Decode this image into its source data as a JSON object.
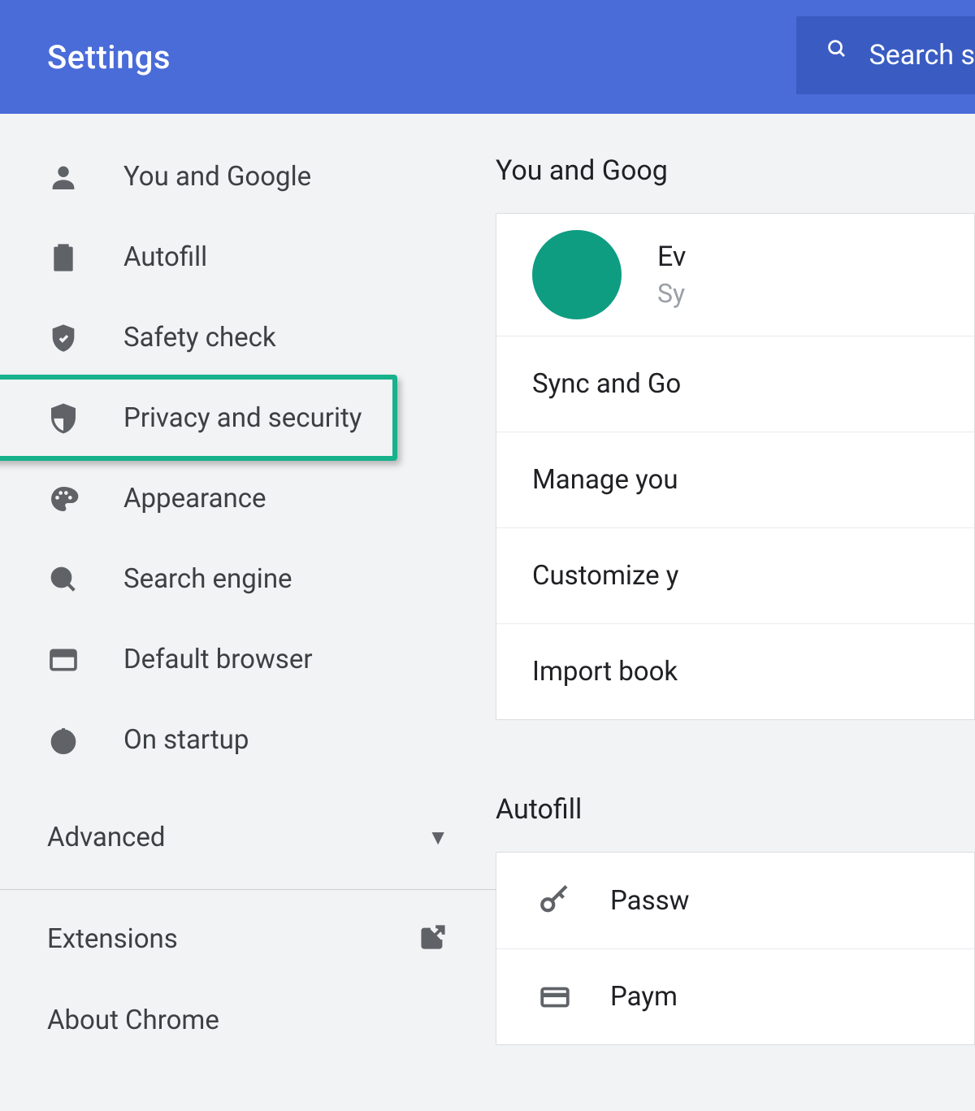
{
  "header": {
    "title": "Settings",
    "search_label": "Search s"
  },
  "sidebar": {
    "items": [
      {
        "id": "you-and-google",
        "icon": "person",
        "label": "You and Google"
      },
      {
        "id": "autofill",
        "icon": "clipboard",
        "label": "Autofill"
      },
      {
        "id": "safety-check",
        "icon": "shield-check",
        "label": "Safety check"
      },
      {
        "id": "privacy",
        "icon": "shield-half",
        "label": "Privacy and security",
        "highlighted": true
      },
      {
        "id": "appearance",
        "icon": "palette",
        "label": "Appearance"
      },
      {
        "id": "search-engine",
        "icon": "search",
        "label": "Search engine"
      },
      {
        "id": "default-browser",
        "icon": "browser",
        "label": "Default browser"
      },
      {
        "id": "on-startup",
        "icon": "power",
        "label": "On startup"
      }
    ],
    "advanced_label": "Advanced",
    "extensions_label": "Extensions",
    "about_label": "About Chrome"
  },
  "main": {
    "section1_title": "You and Goog",
    "profile": {
      "name": "Ev",
      "sub": "Sy",
      "avatar_color": "#0f9d82"
    },
    "account_rows": [
      "Sync and Go",
      "Manage you",
      "Customize y",
      "Import book"
    ],
    "section2_title": "Autofill",
    "autofill_rows": [
      {
        "icon": "key",
        "label": "Passw"
      },
      {
        "icon": "card",
        "label": "Paym"
      }
    ]
  }
}
